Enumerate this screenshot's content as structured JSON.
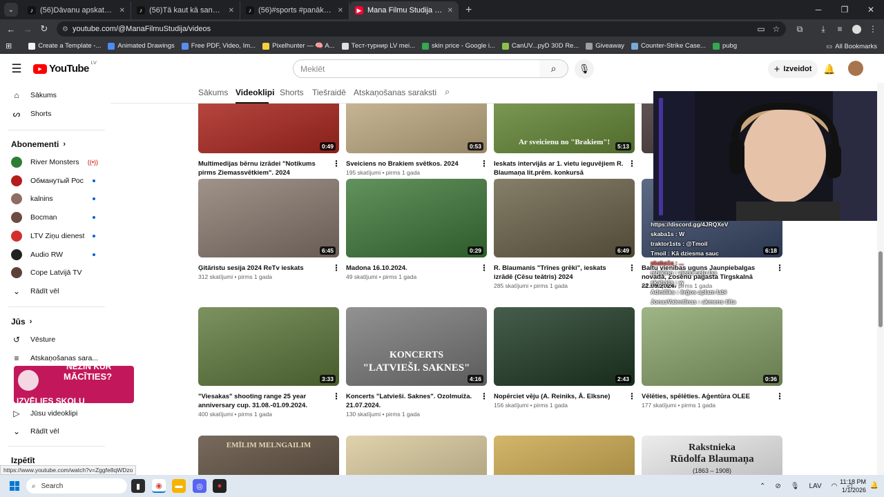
{
  "browser": {
    "tabs": [
      {
        "title": "(56)Dāvanu apskats 2025... #dā",
        "icon": "tiktok-icon"
      },
      {
        "title": "(56)Tā kaut kā sanācis,šādu dzie",
        "icon": "tiktok-icon"
      },
      {
        "title": "(56)#sports #panākumi #cīņa #",
        "icon": "tiktok-icon"
      },
      {
        "title": "Mana Filmu Studija - YouTube",
        "icon": "youtube-icon",
        "active": true
      }
    ],
    "url": "youtube.com/@ManaFilmuStudija/videos",
    "bookmarks": [
      {
        "label": "Create a Template -...",
        "color": "#f2f2f2"
      },
      {
        "label": "Animated Drawings",
        "color": "#4c8bf5"
      },
      {
        "label": "Free PDF, Video, Im...",
        "color": "#5b8def"
      },
      {
        "label": "Pixelhunter — 🧠 A...",
        "color": "#f4d03f"
      },
      {
        "label": "Тест-турнир LV mei...",
        "color": "#e0e0e0"
      },
      {
        "label": "skin price - Google i...",
        "color": "#34a853"
      },
      {
        "label": "CanUV...pyD 30D Re...",
        "color": "#8bc34a"
      },
      {
        "label": "Giveaway",
        "color": "#9e9e9e"
      },
      {
        "label": "Counter-Strike Case...",
        "color": "#7aa7d6"
      },
      {
        "label": "pubg",
        "color": "#34a853"
      }
    ],
    "all_bookmarks": "All Bookmarks"
  },
  "youtube": {
    "logo_text": "YouTube",
    "country": "LV",
    "search_placeholder": "Meklēt",
    "create_label": "Izveidot"
  },
  "sidebar": {
    "top": [
      {
        "label": "Sākums",
        "icon": "home-icon"
      },
      {
        "label": "Shorts",
        "icon": "shorts-icon"
      }
    ],
    "subscriptions_title": "Abonementi",
    "subscriptions": [
      {
        "label": "River Monsters™",
        "color": "#2e7d32",
        "status": "live"
      },
      {
        "label": "Обманутый Рос...",
        "color": "#b71c1c",
        "status": "dot"
      },
      {
        "label": "kalnins",
        "color": "#8d6e63",
        "status": "dot"
      },
      {
        "label": "Bocman",
        "color": "#6d4c41",
        "status": "dot"
      },
      {
        "label": "LTV Ziņu dienests",
        "color": "#d32f2f",
        "status": "dot"
      },
      {
        "label": "Audio RW",
        "color": "#212121",
        "status": "dot"
      },
      {
        "label": "Cope Latvijā TV",
        "color": "#5d4037",
        "status": "none"
      }
    ],
    "show_more": "Rādīt vēl",
    "you_title": "Jūs",
    "you_items": [
      {
        "label": "Vēsture",
        "icon": "history-icon"
      },
      {
        "label": "Atskaņošanas sara...",
        "icon": "playlist-icon"
      },
      {
        "label": "Jūsu videoklipi",
        "icon": "your-videos-icon"
      }
    ],
    "show_more_2": "Rādīt vēl",
    "explore_title": "Izpētīt",
    "promo_line1": "NEZIN KUR",
    "promo_line2": "MĀCĪTIES?",
    "promo_line3": "IZVĒLIES SKOLU"
  },
  "channel_tabs": [
    {
      "label": "Sākums"
    },
    {
      "label": "Videoklipi",
      "active": true
    },
    {
      "label": "Shorts"
    },
    {
      "label": "Tiešraidē"
    },
    {
      "label": "Atskaņošanas saraksti"
    }
  ],
  "videos": [
    {
      "title": "Multimedijas bērnu izrādei \"Notikums pirms Ziemassvētkiem\". 2024",
      "views": "32 skatījumi",
      "age": "pirms 1 gada",
      "duration": "0:49",
      "thumb": "#b52a22"
    },
    {
      "title": "Sveiciens no Brakiem svētkos. 2024",
      "views": "195 skatījumi",
      "age": "pirms 1 gada",
      "duration": "0:53",
      "thumb": "#c9b48a"
    },
    {
      "title": "Ieskats intervijās ar 1. vietu ieguvējiem R. Blaumaņa lit.prēm. konkursā",
      "views": "71 skatījums",
      "age": "pirms 1 gada",
      "duration": "5:13",
      "thumb": "#6b8f3a",
      "overlay": "Ar sveicienu no \"Brakiem\"!"
    },
    {
      "title": "",
      "views": "",
      "age": "",
      "duration": "",
      "thumb": "#4a3a3a"
    },
    {
      "title": "Ģitāristu sesija 2024 ReTv ieskats",
      "views": "312 skatījumi",
      "age": "pirms 1 gada",
      "duration": "6:45",
      "thumb": "#8a7b70"
    },
    {
      "title": "Madona 16.10.2024.",
      "views": "49 skatījumi",
      "age": "pirms 1 gada",
      "duration": "0:29",
      "thumb": "#3f7a3a"
    },
    {
      "title": "R. Blaumanis \"Trīnes grēki\", ieskats izrādē (Cēsu teātris) 2024",
      "views": "285 skatījumi",
      "age": "pirms 1 gada",
      "duration": "6:49",
      "thumb": "#6b6248"
    },
    {
      "title": "Baltu vienības uguns Jaunpiebalgas novadā, Zosēnu pagasta Tirgskalnā 22.09.2024.",
      "views": "84 skatījumi",
      "age": "pirms 1 gada",
      "duration": "6:18",
      "thumb": "#3a4a6a"
    },
    {
      "title": "\"Viesakas\" shooting range 25 year anniversary cup. 31.08.-01.09.2024.",
      "views": "400 skatījumi",
      "age": "pirms 1 gada",
      "duration": "3:33",
      "thumb": "#5f7a3c"
    },
    {
      "title": "Koncerts \"Latvieši. Saknes\". Ozolmuiža. 21.07.2024.",
      "views": "130 skatījumi",
      "age": "pirms 1 gada",
      "duration": "4:16",
      "thumb": "#7a7a7a",
      "overlay": "KONCERTS",
      "overlay2": "\"LATVIEŠI. SAKNES\""
    },
    {
      "title": "Nopērciet vēju (A. Reiniks, Ā. Elksne)",
      "views": "156 skatījumi",
      "age": "pirms 1 gada",
      "duration": "2:43",
      "thumb": "#1f3a24"
    },
    {
      "title": "Vēlēties, spēlēties. Aģentūra OLEE",
      "views": "177 skatījumi",
      "age": "pirms 1 gada",
      "duration": "0:36",
      "thumb": "#8aa56a"
    },
    {
      "title": "",
      "views": "",
      "age": "",
      "duration": "",
      "thumb": "#5a4a3a",
      "overlay": "EMĪLIM MELNGAILIM"
    },
    {
      "title": "",
      "views": "",
      "age": "",
      "duration": "",
      "thumb": "#d8c89a"
    },
    {
      "title": "",
      "views": "",
      "age": "",
      "duration": "",
      "thumb": "#c9a64a"
    },
    {
      "title": "",
      "views": "",
      "age": "",
      "duration": "",
      "thumb": "#e8e8e8",
      "overlay": "Rakstnieka",
      "overlay2": "Rūdolfa Blaumaņa",
      "overlay3": "(1863 – 1908)"
    }
  ],
  "stream_chat": [
    {
      "text": "https://discord.gg/4JRQXeV"
    },
    {
      "text": "skaba1s : W"
    },
    {
      "text": "traktor1sts : @Tmoil"
    },
    {
      "text": "Tmoil : Kā dziesma sauc"
    },
    {
      "text": "skaba1s : ...",
      "style": "red"
    },
    {
      "text": "mbiking : viedu ceļu laa"
    },
    {
      "text": "skaba1s : w"
    },
    {
      "text": "Admiliks : ērģos aplam labi"
    },
    {
      "text": "JonasValentīnas : akmens tilta"
    }
  ],
  "status_url": "https://www.youtube.com/watch?v=Zggfe8qWDzo",
  "taskbar": {
    "search_placeholder": "Search",
    "lang": "LAV",
    "time": "11:18 PM",
    "date": "1/1/2026"
  }
}
